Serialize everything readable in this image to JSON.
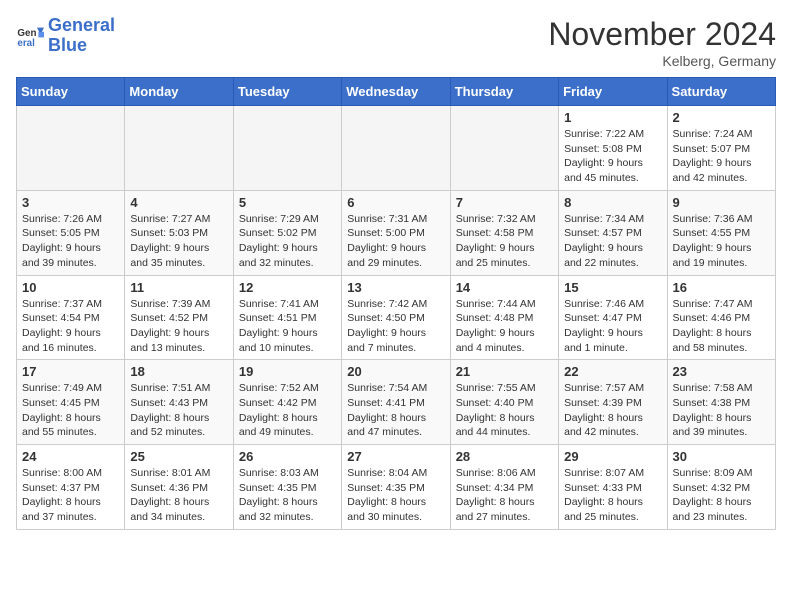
{
  "logo": {
    "line1": "General",
    "line2": "Blue"
  },
  "title": "November 2024",
  "location": "Kelberg, Germany",
  "days_of_week": [
    "Sunday",
    "Monday",
    "Tuesday",
    "Wednesday",
    "Thursday",
    "Friday",
    "Saturday"
  ],
  "weeks": [
    [
      {
        "day": "",
        "info": ""
      },
      {
        "day": "",
        "info": ""
      },
      {
        "day": "",
        "info": ""
      },
      {
        "day": "",
        "info": ""
      },
      {
        "day": "",
        "info": ""
      },
      {
        "day": "1",
        "info": "Sunrise: 7:22 AM\nSunset: 5:08 PM\nDaylight: 9 hours\nand 45 minutes."
      },
      {
        "day": "2",
        "info": "Sunrise: 7:24 AM\nSunset: 5:07 PM\nDaylight: 9 hours\nand 42 minutes."
      }
    ],
    [
      {
        "day": "3",
        "info": "Sunrise: 7:26 AM\nSunset: 5:05 PM\nDaylight: 9 hours\nand 39 minutes."
      },
      {
        "day": "4",
        "info": "Sunrise: 7:27 AM\nSunset: 5:03 PM\nDaylight: 9 hours\nand 35 minutes."
      },
      {
        "day": "5",
        "info": "Sunrise: 7:29 AM\nSunset: 5:02 PM\nDaylight: 9 hours\nand 32 minutes."
      },
      {
        "day": "6",
        "info": "Sunrise: 7:31 AM\nSunset: 5:00 PM\nDaylight: 9 hours\nand 29 minutes."
      },
      {
        "day": "7",
        "info": "Sunrise: 7:32 AM\nSunset: 4:58 PM\nDaylight: 9 hours\nand 25 minutes."
      },
      {
        "day": "8",
        "info": "Sunrise: 7:34 AM\nSunset: 4:57 PM\nDaylight: 9 hours\nand 22 minutes."
      },
      {
        "day": "9",
        "info": "Sunrise: 7:36 AM\nSunset: 4:55 PM\nDaylight: 9 hours\nand 19 minutes."
      }
    ],
    [
      {
        "day": "10",
        "info": "Sunrise: 7:37 AM\nSunset: 4:54 PM\nDaylight: 9 hours\nand 16 minutes."
      },
      {
        "day": "11",
        "info": "Sunrise: 7:39 AM\nSunset: 4:52 PM\nDaylight: 9 hours\nand 13 minutes."
      },
      {
        "day": "12",
        "info": "Sunrise: 7:41 AM\nSunset: 4:51 PM\nDaylight: 9 hours\nand 10 minutes."
      },
      {
        "day": "13",
        "info": "Sunrise: 7:42 AM\nSunset: 4:50 PM\nDaylight: 9 hours\nand 7 minutes."
      },
      {
        "day": "14",
        "info": "Sunrise: 7:44 AM\nSunset: 4:48 PM\nDaylight: 9 hours\nand 4 minutes."
      },
      {
        "day": "15",
        "info": "Sunrise: 7:46 AM\nSunset: 4:47 PM\nDaylight: 9 hours\nand 1 minute."
      },
      {
        "day": "16",
        "info": "Sunrise: 7:47 AM\nSunset: 4:46 PM\nDaylight: 8 hours\nand 58 minutes."
      }
    ],
    [
      {
        "day": "17",
        "info": "Sunrise: 7:49 AM\nSunset: 4:45 PM\nDaylight: 8 hours\nand 55 minutes."
      },
      {
        "day": "18",
        "info": "Sunrise: 7:51 AM\nSunset: 4:43 PM\nDaylight: 8 hours\nand 52 minutes."
      },
      {
        "day": "19",
        "info": "Sunrise: 7:52 AM\nSunset: 4:42 PM\nDaylight: 8 hours\nand 49 minutes."
      },
      {
        "day": "20",
        "info": "Sunrise: 7:54 AM\nSunset: 4:41 PM\nDaylight: 8 hours\nand 47 minutes."
      },
      {
        "day": "21",
        "info": "Sunrise: 7:55 AM\nSunset: 4:40 PM\nDaylight: 8 hours\nand 44 minutes."
      },
      {
        "day": "22",
        "info": "Sunrise: 7:57 AM\nSunset: 4:39 PM\nDaylight: 8 hours\nand 42 minutes."
      },
      {
        "day": "23",
        "info": "Sunrise: 7:58 AM\nSunset: 4:38 PM\nDaylight: 8 hours\nand 39 minutes."
      }
    ],
    [
      {
        "day": "24",
        "info": "Sunrise: 8:00 AM\nSunset: 4:37 PM\nDaylight: 8 hours\nand 37 minutes."
      },
      {
        "day": "25",
        "info": "Sunrise: 8:01 AM\nSunset: 4:36 PM\nDaylight: 8 hours\nand 34 minutes."
      },
      {
        "day": "26",
        "info": "Sunrise: 8:03 AM\nSunset: 4:35 PM\nDaylight: 8 hours\nand 32 minutes."
      },
      {
        "day": "27",
        "info": "Sunrise: 8:04 AM\nSunset: 4:35 PM\nDaylight: 8 hours\nand 30 minutes."
      },
      {
        "day": "28",
        "info": "Sunrise: 8:06 AM\nSunset: 4:34 PM\nDaylight: 8 hours\nand 27 minutes."
      },
      {
        "day": "29",
        "info": "Sunrise: 8:07 AM\nSunset: 4:33 PM\nDaylight: 8 hours\nand 25 minutes."
      },
      {
        "day": "30",
        "info": "Sunrise: 8:09 AM\nSunset: 4:32 PM\nDaylight: 8 hours\nand 23 minutes."
      }
    ]
  ]
}
